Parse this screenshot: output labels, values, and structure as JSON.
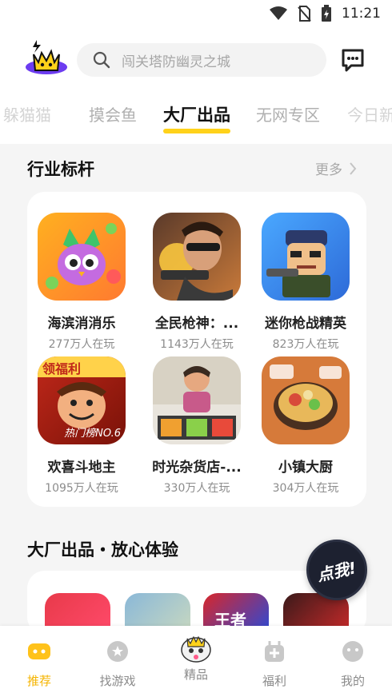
{
  "status_bar": {
    "time": "11:21"
  },
  "search": {
    "placeholder": "闯关塔防幽灵之城"
  },
  "tabs": [
    {
      "label": "躲猫猫"
    },
    {
      "label": "摸会鱼"
    },
    {
      "label": "大厂出品"
    },
    {
      "label": "无网专区"
    },
    {
      "label": "今日新"
    }
  ],
  "section1": {
    "title": "行业标杆",
    "more": "更多",
    "games": [
      {
        "name": "海滨消消乐",
        "players": "277万人在玩"
      },
      {
        "name": "全民枪神：...",
        "players": "1143万人在玩"
      },
      {
        "name": "迷你枪战精英",
        "players": "823万人在玩"
      },
      {
        "name": "欢喜斗地主",
        "players": "1095万人在玩",
        "icon_text_top": "领福利",
        "icon_text_bottom": "热门榜NO.6"
      },
      {
        "name": "时光杂货店-...",
        "players": "330万人在玩"
      },
      {
        "name": "小镇大厨",
        "players": "304万人在玩"
      }
    ]
  },
  "section2": {
    "title": "大厂出品・放心体验",
    "partial_icon_text": "王者"
  },
  "float_button": {
    "label": "点我!"
  },
  "bottom_nav": [
    {
      "label": "推荐",
      "icon": "game-controller-icon",
      "active": true
    },
    {
      "label": "找游戏",
      "icon": "search-games-icon"
    },
    {
      "label": "精品",
      "icon": "mascot-icon"
    },
    {
      "label": "福利",
      "icon": "gift-bag-icon"
    },
    {
      "label": "我的",
      "icon": "profile-face-icon"
    }
  ],
  "colors": {
    "accent": "#ffd21a",
    "active_nav": "#f5b400"
  }
}
